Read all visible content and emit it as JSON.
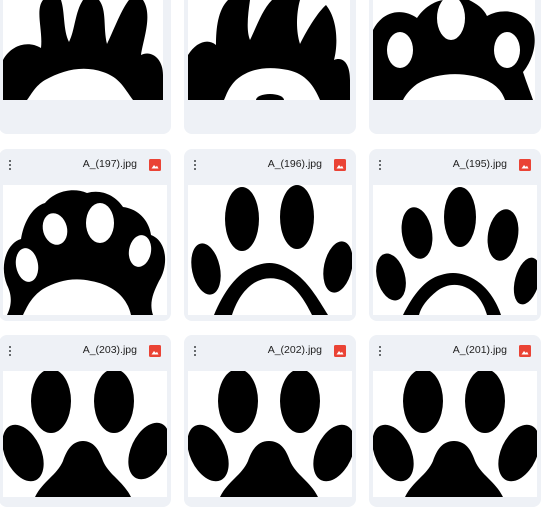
{
  "files": [
    {
      "name": "",
      "icon": "image-file-icon"
    },
    {
      "name": "",
      "icon": "image-file-icon"
    },
    {
      "name": "",
      "icon": "image-file-icon"
    },
    {
      "name": "A_(197).jpg",
      "icon": "image-file-icon"
    },
    {
      "name": "A_(196).jpg",
      "icon": "image-file-icon"
    },
    {
      "name": "A_(195).jpg",
      "icon": "image-file-icon"
    },
    {
      "name": "A_(203).jpg",
      "icon": "image-file-icon"
    },
    {
      "name": "A_(202).jpg",
      "icon": "image-file-icon"
    },
    {
      "name": "A_(201).jpg",
      "icon": "image-file-icon"
    }
  ],
  "colors": {
    "card_bg": "#eef1f6",
    "image_icon": "#ea4335",
    "paw": "#000000"
  },
  "icons": {
    "menu": "more-vert-icon",
    "file": "image-file-icon"
  }
}
